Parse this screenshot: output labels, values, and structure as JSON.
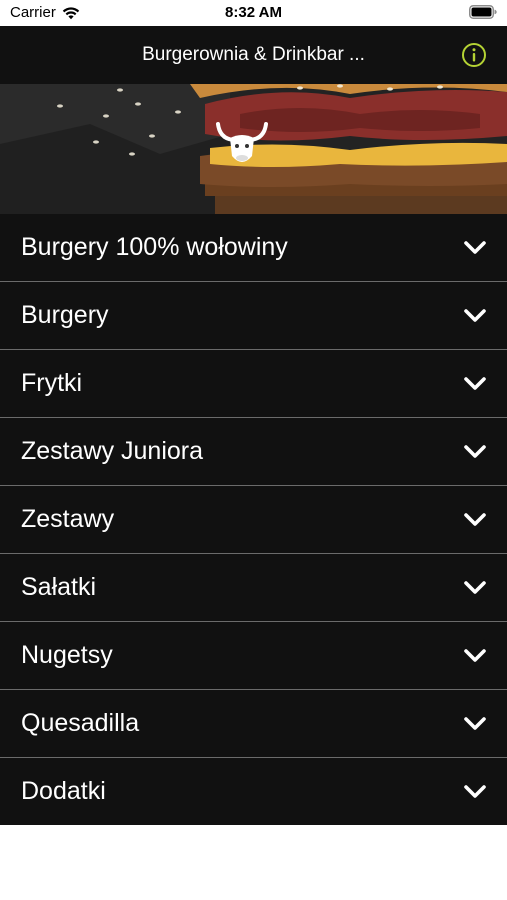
{
  "status_bar": {
    "carrier": "Carrier",
    "time": "8:32 AM",
    "wifi_icon": "wifi-icon",
    "battery_icon": "battery-icon"
  },
  "nav_bar": {
    "title": "Burgerownia & Drinkbar ...",
    "info_icon": "info-icon",
    "accent_color": "#b5d334"
  },
  "hero": {
    "image": "burger-banner",
    "logo": "bull-logo"
  },
  "menu": {
    "chevron_icon": "chevron-down-icon",
    "items": [
      {
        "label": "Burgery 100% wołowiny"
      },
      {
        "label": "Burgery"
      },
      {
        "label": "Frytki"
      },
      {
        "label": "Zestawy Juniora"
      },
      {
        "label": "Zestawy"
      },
      {
        "label": "Sałatki"
      },
      {
        "label": "Nugetsy"
      },
      {
        "label": "Quesadilla"
      },
      {
        "label": "Dodatki"
      }
    ]
  }
}
